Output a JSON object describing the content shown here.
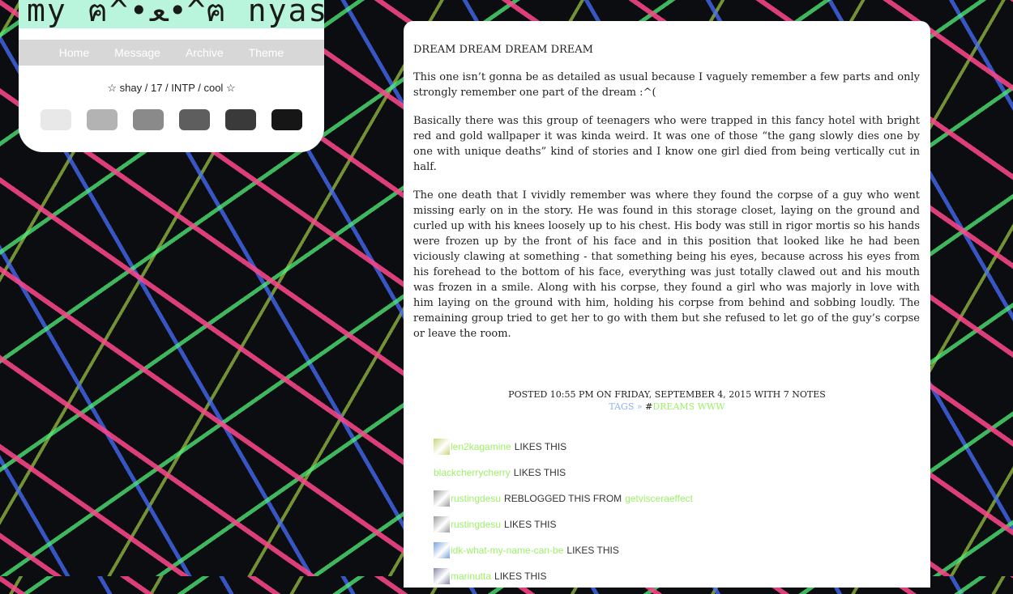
{
  "blog": {
    "title": "my ฅ^•ﻌ•^ฅ nyas?",
    "nav": [
      "Home",
      "Message",
      "Archive",
      "Theme"
    ],
    "description": "☆ shay / 17 / INTP / cool ☆",
    "swatches": [
      "#e8e8e8",
      "#b3b3b3",
      "#8a8a8a",
      "#5e5e5e",
      "#3a3a3a",
      "#161616"
    ]
  },
  "post": {
    "title": "DREAM DREAM DREAM DREAM",
    "paragraphs": [
      "This one isn’t gonna be as detailed as usual because I vaguely remember a few parts and only strongly remember one part of the dream :^(",
      "Basically there was this group of teenagers who were trapped in this fancy hotel with bright red and gold wallpaper it was kinda weird. It was one of those “the gang slowly dies one by one with unique deaths” kind of stories and I know one girl died from being vertically cut in half.",
      "The one death that I vividly remember was where they found the corpse of a guy who went missing early on in the story. He was found in this storage closet, laying on the ground and curled up with his knees loosely up to his chest. His body was still in rigor mortis so his hands were frozen up by the front of his face and in this position that looked like he had been viciously clawing at something - that something being his eyes, because across his eyes from his forehead to the bottom of his face, everything was just totally clawed out and his mouth was frozen in a smile. Along with his corpse, they found a girl who was majorly in love with him laying on the ground with him, holding his corpse from behind and sobbing loudly. The remaining group tried to get her to go with them but she refused to let go of the guy’s corpse or leave the room."
    ],
    "meta": "POSTED 10:55 PM ON FRIDAY, SEPTEMBER 4, 2015 WITH 7 NOTES",
    "tags_label": "TAGS »",
    "tag_prefix": "#",
    "tag": "DREAMS WWW",
    "notes": [
      {
        "avatar_color": "#c9d47a",
        "user": "len2kagamine",
        "action": "LIKES THIS",
        "source": ""
      },
      {
        "avatar_color": "",
        "user": "blackcherrycherry",
        "action": "LIKES THIS",
        "source": ""
      },
      {
        "avatar_color": "#9a9a9a",
        "user": "rustingdesu",
        "action": "REBLOGGED THIS FROM",
        "source": "getvisceraeffect"
      },
      {
        "avatar_color": "#9a9a9a",
        "user": "rustingdesu",
        "action": "LIKES THIS",
        "source": ""
      },
      {
        "avatar_color": "#7aa0e0",
        "user": "idk-what-my-name-can-be",
        "action": "LIKES THIS",
        "source": ""
      },
      {
        "avatar_color": "#8888aa",
        "user": "marinutta",
        "action": "LIKES THIS",
        "source": ""
      }
    ]
  }
}
